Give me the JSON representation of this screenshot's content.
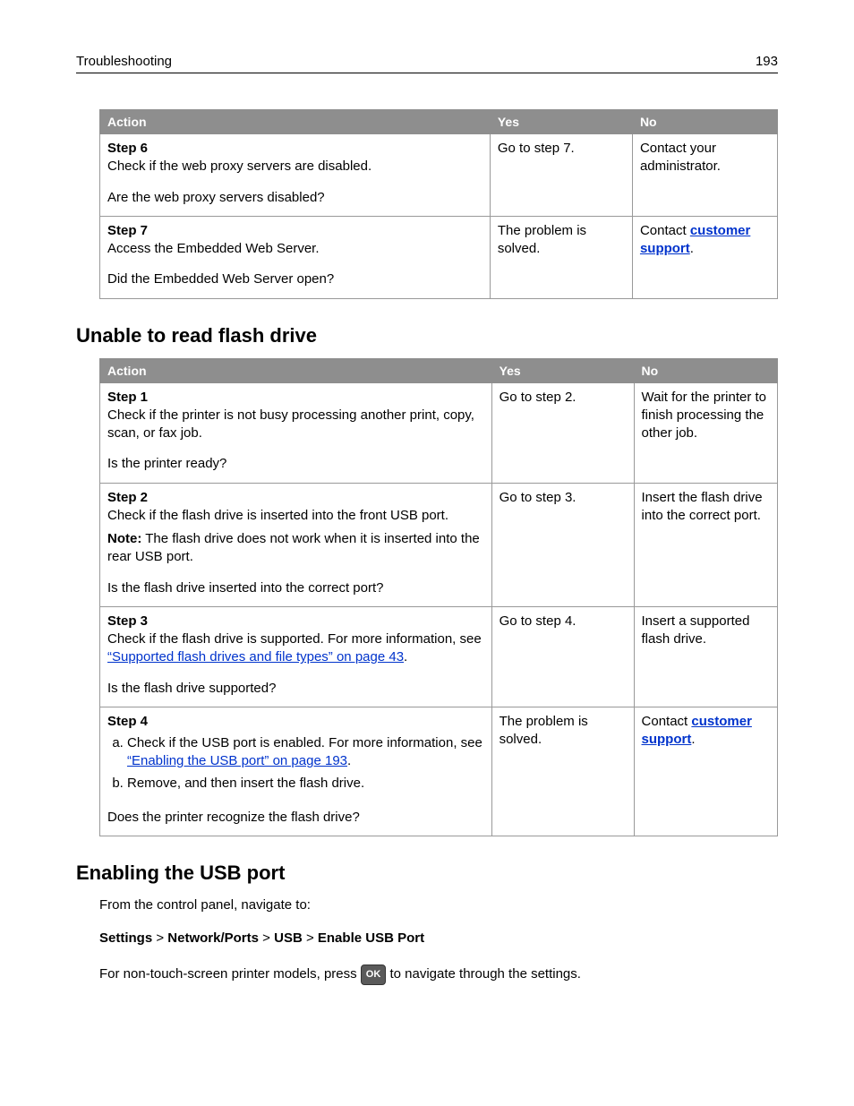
{
  "header": {
    "section": "Troubleshooting",
    "pageNumber": "193"
  },
  "table1": {
    "headers": {
      "action": "Action",
      "yes": "Yes",
      "no": "No"
    },
    "rows": [
      {
        "stepTitle": "Step 6",
        "line1": "Check if the web proxy servers are disabled.",
        "question": "Are the web proxy servers disabled?",
        "yes": "Go to step 7.",
        "no": "Contact your administrator."
      },
      {
        "stepTitle": "Step 7",
        "line1": "Access the Embedded Web Server.",
        "question": "Did the Embedded Web Server open?",
        "yes": "The problem is solved.",
        "noPrefix": "Contact ",
        "noLink": "customer support",
        "noSuffix": "."
      }
    ]
  },
  "heading2": "Unable to read flash drive",
  "table2": {
    "headers": {
      "action": "Action",
      "yes": "Yes",
      "no": "No"
    },
    "rows": [
      {
        "stepTitle": "Step 1",
        "line1": "Check if the printer is not busy processing another print, copy, scan, or fax job.",
        "question": "Is the printer ready?",
        "yes": "Go to step 2.",
        "no": "Wait for the printer to finish processing the other job."
      },
      {
        "stepTitle": "Step 2",
        "line1": "Check if the flash drive is inserted into the front USB port.",
        "noteLabel": "Note:",
        "noteText": " The flash drive does not work when it is inserted into the rear USB port.",
        "question": "Is the flash drive inserted into the correct port?",
        "yes": "Go to step 3.",
        "no": "Insert the flash drive into the correct port."
      },
      {
        "stepTitle": "Step 3",
        "line1a": "Check if the flash drive is supported. For more information, see ",
        "link1": "“Supported flash drives and file types” on page 43",
        "line1b": ".",
        "question": "Is the flash drive supported?",
        "yes": "Go to step 4.",
        "no": "Insert a supported flash drive."
      },
      {
        "stepTitle": "Step 4",
        "subA_a": "Check if the USB port is enabled. For more information, see ",
        "subA_link": "“Enabling the USB port” on page 193",
        "subA_b": ".",
        "subB": "Remove, and then insert the flash drive.",
        "question": "Does the printer recognize the flash drive?",
        "yes": "The problem is solved.",
        "noPrefix": "Contact ",
        "noLink": "customer support",
        "noSuffix": "."
      }
    ]
  },
  "heading3": "Enabling the USB port",
  "usb": {
    "intro": "From the control panel, navigate to:",
    "path1": "Settings",
    "sep": " > ",
    "path2": "Network/Ports",
    "path3": "USB",
    "path4": "Enable USB Port",
    "instr1": "For non-touch-screen printer models, press ",
    "okLabel": "OK",
    "instr2": " to navigate through the settings."
  }
}
